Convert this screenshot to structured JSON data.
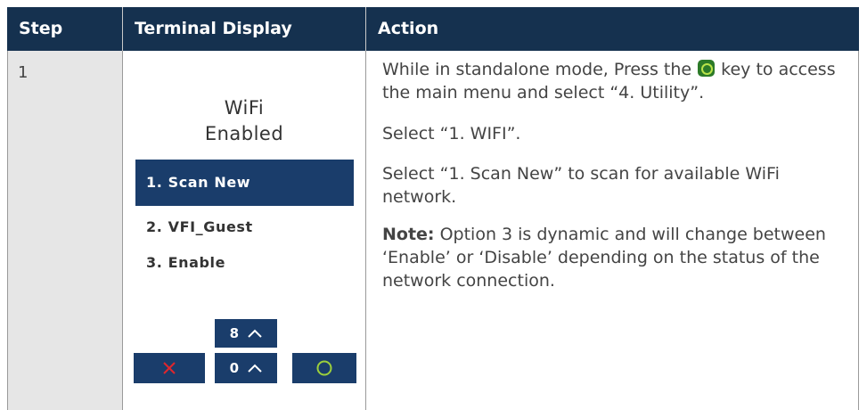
{
  "header": {
    "step": "Step",
    "display": "Terminal Display",
    "action": "Action"
  },
  "row": {
    "step": "1",
    "terminal": {
      "title_line1": "WiFi",
      "title_line2": "Enabled",
      "menu": [
        "1. Scan New",
        "2. VFI_Guest",
        "3. Enable"
      ],
      "selected_index": 0,
      "keys": {
        "key8": "8",
        "key0": "0"
      }
    },
    "action": {
      "p1_before": "While in standalone mode, Press the",
      "p1_after": "key to access the main menu and select “4. Utility”.",
      "p2": "Select “1. WIFI”.",
      "p3": "Select “1. Scan New” to scan for available WiFi network.",
      "p4_label": "Note:",
      "p4_text": "Option 3 is dynamic and will change between ‘Enable’ or ‘Disable’ depending on the status of the network connection."
    }
  },
  "colors": {
    "header_bg": "#15314f",
    "key_bg": "#1a3d6b",
    "cancel_red": "#e0262c",
    "enter_green": "#9ccf3c",
    "step_col_bg": "#e6e6e6"
  }
}
